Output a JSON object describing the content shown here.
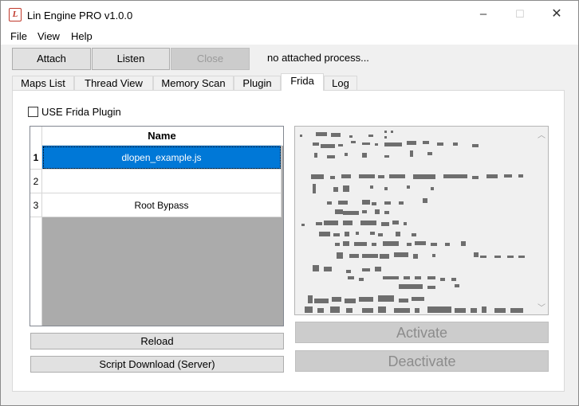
{
  "window": {
    "title": "Lin Engine PRO v1.0.0",
    "icon_letter": "L"
  },
  "window_controls": {
    "minimize": "–",
    "maximize": "☐",
    "close": "✕"
  },
  "menu": {
    "items": [
      "File",
      "View",
      "Help"
    ]
  },
  "toolbar": {
    "attach": "Attach",
    "listen": "Listen",
    "close": "Close",
    "status": "no attached process..."
  },
  "tabs": [
    "Maps List",
    "Thread View",
    "Memory Scan",
    "Plugin",
    "Frida",
    "Log"
  ],
  "active_tab": "Frida",
  "frida": {
    "use_plugin_label": "USE Frida Plugin",
    "use_plugin_checked": false,
    "grid": {
      "column": "Name",
      "rows": [
        {
          "num": "1",
          "name": "dlopen_example.js",
          "selected": true
        },
        {
          "num": "2",
          "name": "",
          "selected": false
        },
        {
          "num": "3",
          "name": "Root Bypass",
          "selected": false
        }
      ]
    },
    "reload_label": "Reload",
    "download_label": "Script Download (Server)",
    "activate_label": "Activate",
    "deactivate_label": "Deactivate"
  },
  "colors": {
    "selection": "#0078d7",
    "logo": "#c0392b"
  }
}
